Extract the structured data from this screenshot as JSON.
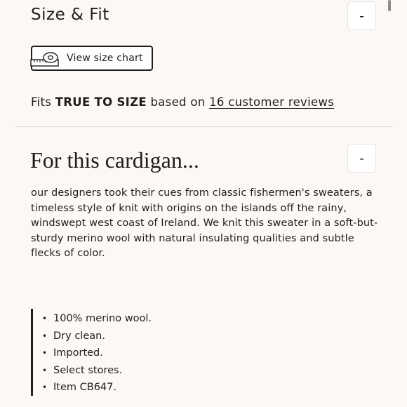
{
  "size_fit": {
    "title": "Size & Fit",
    "toggle_label": "-",
    "size_chart_label": "View size chart",
    "fit_prefix": "Fits",
    "fit_value": "TRUE TO SIZE",
    "fit_middle": "based on",
    "reviews_link": "16 customer reviews"
  },
  "details": {
    "title": "For this cardigan...",
    "toggle_label": "-",
    "description": "our designers took their cues from classic fishermen's sweaters, a timeless style of knit with origins on the islands off the rainy, windswept west coast of Ireland. We knit this sweater in a soft-but-sturdy merino wool with natural insulating qualities and subtle flecks of color.",
    "bullets": [
      "100% merino wool.",
      "Dry clean.",
      "Imported.",
      "Select stores.",
      "Item CB647."
    ]
  },
  "icons": {
    "tape": "measuring-tape-icon",
    "bullet": "•"
  }
}
